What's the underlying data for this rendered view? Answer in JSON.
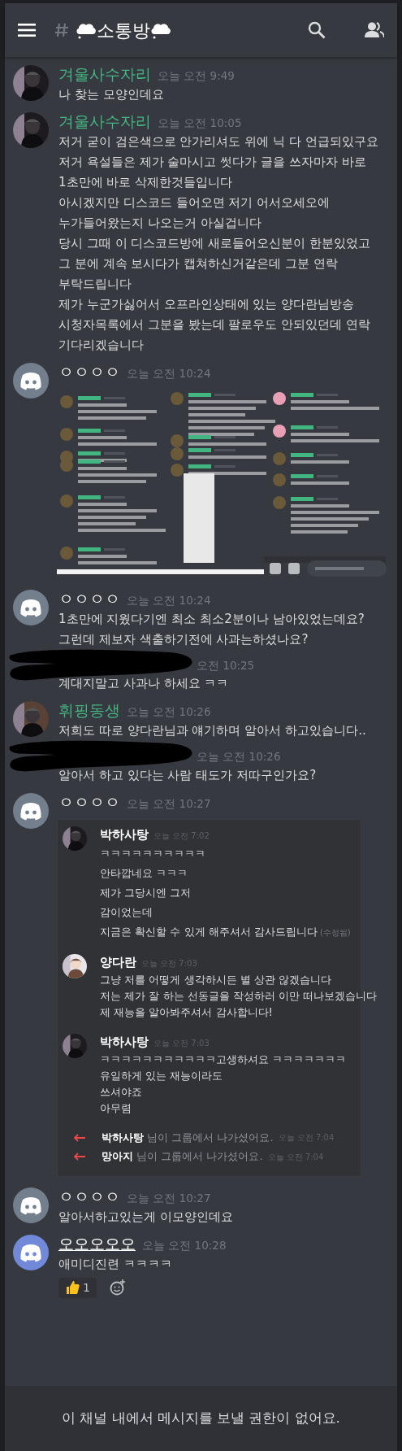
{
  "header": {
    "title": "소통방"
  },
  "messages": [
    {
      "author": "겨울사수자리",
      "color": "#43b581",
      "underlined": false,
      "time": "오늘 오전 9:49",
      "lines": [
        "나 찾는 모양인데요"
      ]
    },
    {
      "author": "겨울사수자리",
      "color": "#43b581",
      "underlined": false,
      "time": "오늘 오전 10:05",
      "lines": [
        "저거 굳이 검은색으로 안가리셔도 위에 닉 다 언급되있구요",
        "저거 욕설들은 제가 술마시고 썻다가 글을 쓰자마자 바로",
        "1초만에 바로 삭제한것들입니다",
        "아시겠지만 디스코드 들어오면 저기 어서오세오에",
        "누가들어왔는지 나오는거 아실겁니다",
        "당시 그때 이 디스코드방에 새로들어오신분이 한분있었고",
        "그 분에 계속 보시다가 캡쳐하신거같은데 그분 연락",
        "부탁드립니다",
        "제가 누군가싫어서 오프라인상태에 있는 양다란님방송",
        "시청자목록에서 그분을 봤는데 팔로우도 안되있던데 연락",
        "기다리겠습니다"
      ]
    },
    {
      "kind": "discord-gray",
      "author": "ㅇㅇㅇㅇ",
      "color": "#ffffff",
      "underlined": false,
      "time": "오늘 오전 10:24",
      "attachment": {
        "kind": "screenshot"
      }
    },
    {
      "kind": "discord-gray",
      "author": "ㅇㅇㅇㅇ",
      "color": "#ffffff",
      "underlined": false,
      "time": "오늘 오전 10:24",
      "lines": [
        "1초만에 지웠다기엔 최소 최소2분이나 남아있었는데요?",
        "그런데 제보자 색출하기전에 사과는하셨나요?"
      ]
    },
    {
      "kind": "redacted",
      "time": "오전 10:25",
      "lines": [
        "계대지말고 사과나 하세요 ㅋㅋ"
      ]
    },
    {
      "author": "휘핑동생",
      "color": "#43b581",
      "underlined": false,
      "time": "오늘 오전 10:26",
      "lines": [
        "저희도 따로 양다란님과 얘기하며 알아서 하고있습니다.."
      ]
    },
    {
      "kind": "redacted",
      "time": "오늘 오전 10:26",
      "lines": [
        "알아서 하고 있다는 사람 태도가 저따구인가요?"
      ]
    },
    {
      "kind": "discord-gray",
      "author": "ㅇㅇㅇㅇ",
      "color": "#ffffff",
      "underlined": false,
      "time": "오늘 오전 10:27",
      "embed": [
        {
          "kind": "message",
          "author": "박하사탕",
          "time": "오늘 오전 7:02",
          "lines": [
            "ㅋㅋㅋㅋㅋㅋㅋㅋㅋㅋ",
            "안타깝네요 ㅋㅋㅋ",
            "제가 그당시엔 그저",
            "감이었는데",
            "지금은 확신할 수 있게 해주셔서 감사드립니다"
          ],
          "edited": "(수정됨)"
        },
        {
          "kind": "message",
          "author": "양다란",
          "time": "오늘 오전 7:03",
          "lines": [
            "그냥 저를 어떻게 생각하시든 별 상관 않겠습니다",
            "저는 제가 잘 하는 선동글을 작성하러 이만 떠나보겠습니다",
            "제 재능을 알아봐주셔서 감사합니다!"
          ]
        },
        {
          "kind": "message",
          "author": "박하사탕",
          "time": "오늘 오전 7:03",
          "lines": [
            "ㅋㅋㅋㅋㅋㅋㅋㅋㅋㅋㅋ고생하셔요 ㅋㅋㅋㅋㅋㅋㅋ",
            "유일하게 있는 재능이라도",
            "쓰셔야죠",
            "아무렴"
          ]
        },
        {
          "kind": "leave",
          "author": "박하사탕",
          "text": "님이 그룹에서 나가셨어요.",
          "time": "오늘 오전 7:04"
        },
        {
          "kind": "leave",
          "author": "망아지",
          "text": "님이 그룹에서 나가셨어요.",
          "time": "오늘 오전 7:04"
        }
      ]
    },
    {
      "kind": "discord-gray",
      "author": "ㅇㅇㅇㅇ",
      "color": "#ffffff",
      "underlined": false,
      "time": "오늘 오전 10:27",
      "lines": [
        "알아서하고있는게 이모양인데요"
      ]
    },
    {
      "kind": "discord-blue",
      "author": "오오오오오",
      "color": "#ffffff",
      "underlined": true,
      "time": "오늘 오전 10:28",
      "lines": [
        "애미디진련 ㅋㅋㅋㅋ"
      ],
      "reactions": [
        {
          "count": "1"
        }
      ]
    }
  ],
  "footer": {
    "notice": "이 채널 내에서 메시지를 보낼 권한이 없어요."
  }
}
